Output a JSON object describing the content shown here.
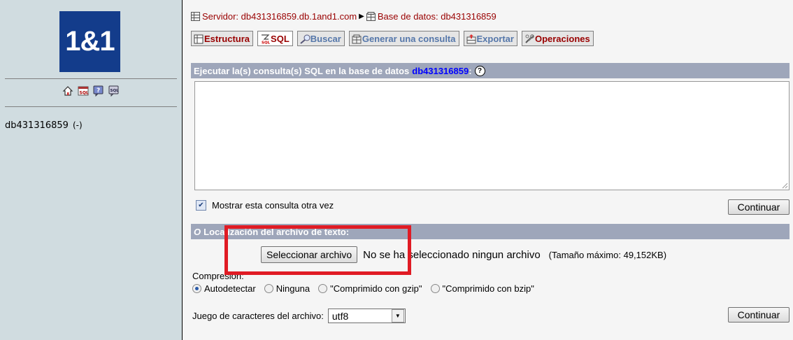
{
  "left": {
    "logo_text": "1&1",
    "nav_icons": [
      "home-icon",
      "sql-query-icon",
      "help-icon",
      "docs-icon"
    ],
    "db_name": "db431316859",
    "db_count": "(-)"
  },
  "breadcrumb": {
    "server_label": "Servidor: db431316859.db.1and1.com",
    "separator": "▶",
    "database_label": "Base de datos: db431316859"
  },
  "tabs": [
    {
      "label": "Estructura",
      "icon": "structure-icon",
      "active": false
    },
    {
      "label": "SQL",
      "icon": "sql-icon",
      "active": true
    },
    {
      "label": "Buscar",
      "icon": "search-icon",
      "active": false
    },
    {
      "label": "Generar una consulta",
      "icon": "query-builder-icon",
      "active": false
    },
    {
      "label": "Exportar",
      "icon": "export-icon",
      "active": false
    },
    {
      "label": "Operaciones",
      "icon": "operations-icon",
      "active": false
    }
  ],
  "sql_section": {
    "title_prefix": "Ejecutar la(s) consulta(s) SQL en la base de datos",
    "db_name": "db431316859",
    "colon": ":",
    "help_glyph": "?",
    "query_value": "",
    "show_again_label": "Mostrar esta consulta otra vez",
    "show_again_checked": true,
    "continue_label": "Continuar"
  },
  "upload_section": {
    "title_o": "O",
    "title": "Localización del archivo de texto:",
    "choose_file_label": "Seleccionar archivo",
    "no_file_text": "No se ha seleccionado ningun archivo",
    "max_size_text": "(Tamaño máximo: 49,152KB)",
    "compression_label": "Compresión:",
    "compression_options": [
      "Autodetectar",
      "Ninguna",
      "\"Comprimido con gzip\"",
      "\"Comprimido con bzip\""
    ],
    "compression_selected": "Autodetectar",
    "charset_label": "Juego de caracteres del archivo:",
    "charset_value": "utf8",
    "continue_label": "Continuar"
  },
  "colors": {
    "left_bg": "#d0dce0",
    "logo_bg": "#133c8b",
    "header_bar": "#9ea6ba",
    "highlight": "#e01b24",
    "breadcrumb_text": "#990000"
  }
}
